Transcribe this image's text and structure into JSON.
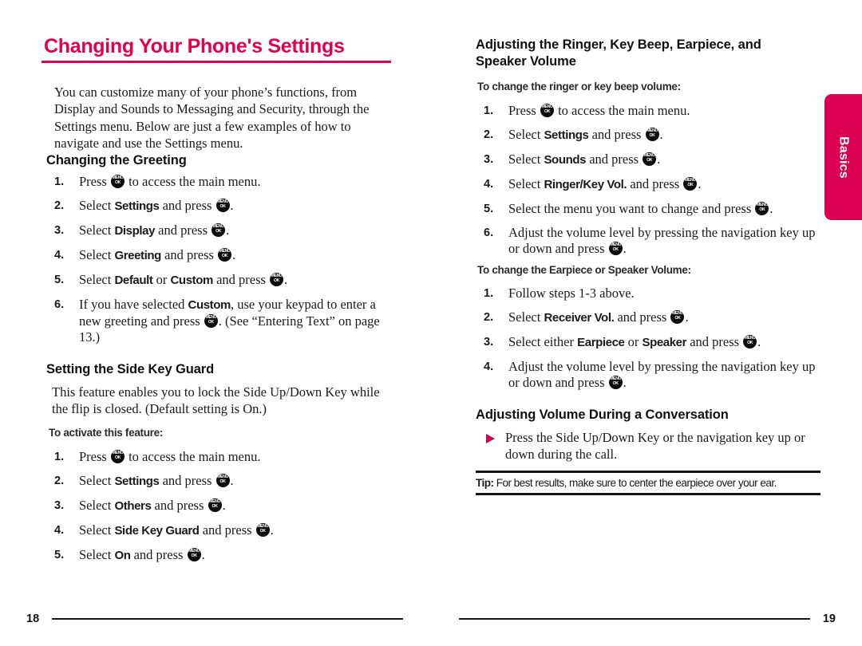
{
  "document": {
    "title": "Changing Your Phone's Settings",
    "accent_color": "#E3004F",
    "menu_key_icon": {
      "line1": "MENU",
      "line2": "OK"
    }
  },
  "side_tab": {
    "label": "Basics"
  },
  "left_page": {
    "folio": "18",
    "intro": "You can customize many of your phone’s functions, from Display and Sounds to Messaging and Security, through the Settings menu. Below are just a few examples of how to navigate and use the Settings menu.",
    "sections": [
      {
        "heading": "Changing the Greeting",
        "steps": [
          {
            "num": "1.",
            "html": "Press <span class=\"menukey\" data-name=\"menu-ok-key-icon\" data-interactable=\"false\"><i class=\"k1\">MENU</i><i class=\"k2\">OK</i></span> to access the main menu."
          },
          {
            "num": "2.",
            "html": "Select <b>Settings</b> and press <span class=\"menukey\" data-name=\"menu-ok-key-icon\" data-interactable=\"false\"><i class=\"k1\">MENU</i><i class=\"k2\">OK</i></span>."
          },
          {
            "num": "3.",
            "html": "Select <b>Display</b> and press <span class=\"menukey\" data-name=\"menu-ok-key-icon\" data-interactable=\"false\"><i class=\"k1\">MENU</i><i class=\"k2\">OK</i></span>."
          },
          {
            "num": "4.",
            "html": "Select <b>Greeting</b> and press <span class=\"menukey\" data-name=\"menu-ok-key-icon\" data-interactable=\"false\"><i class=\"k1\">MENU</i><i class=\"k2\">OK</i></span>."
          },
          {
            "num": "5.",
            "html": "Select <b>Default</b> or <b>Custom</b> and press <span class=\"menukey\" data-name=\"menu-ok-key-icon\" data-interactable=\"false\"><i class=\"k1\">MENU</i><i class=\"k2\">OK</i></span>."
          },
          {
            "num": "6.",
            "html": "If you have selected <b>Custom</b>, use your keypad to enter a new greeting and press <span class=\"menukey\" data-name=\"menu-ok-key-icon\" data-interactable=\"false\"><i class=\"k1\">MENU</i><i class=\"k2\">OK</i></span>. (See “Entering Text” on page 13.)"
          }
        ]
      },
      {
        "heading": "Setting the Side Key Guard",
        "body": "This feature enables you to lock the Side Up/Down Key while the flip is closed. (Default setting is On.)",
        "subhead": "To activate this feature:",
        "steps": [
          {
            "num": "1.",
            "html": "Press <span class=\"menukey\" data-name=\"menu-ok-key-icon\" data-interactable=\"false\"><i class=\"k1\">MENU</i><i class=\"k2\">OK</i></span> to access the main menu."
          },
          {
            "num": "2.",
            "html": "Select <b>Settings</b> and press <span class=\"menukey\" data-name=\"menu-ok-key-icon\" data-interactable=\"false\"><i class=\"k1\">MENU</i><i class=\"k2\">OK</i></span>."
          },
          {
            "num": "3.",
            "html": "Select <b>Others</b> and press <span class=\"menukey\" data-name=\"menu-ok-key-icon\" data-interactable=\"false\"><i class=\"k1\">MENU</i><i class=\"k2\">OK</i></span>."
          },
          {
            "num": "4.",
            "html": "Select <b>Side Key Guard</b> and press <span class=\"menukey\" data-name=\"menu-ok-key-icon\" data-interactable=\"false\"><i class=\"k1\">MENU</i><i class=\"k2\">OK</i></span>."
          },
          {
            "num": "5.",
            "html": "Select <b>On</b> and press <span class=\"menukey\" data-name=\"menu-ok-key-icon\" data-interactable=\"false\"><i class=\"k1\">MENU</i><i class=\"k2\">OK</i></span>."
          }
        ]
      }
    ]
  },
  "right_page": {
    "folio": "19",
    "heading_1": "Adjusting the Ringer, Key Beep, Earpiece, and Speaker Volume",
    "subhead_1": "To change the ringer or key beep volume:",
    "steps_1": [
      {
        "num": "1.",
        "html": "Press <span class=\"menukey\" data-name=\"menu-ok-key-icon\" data-interactable=\"false\"><i class=\"k1\">MENU</i><i class=\"k2\">OK</i></span> to access the main menu."
      },
      {
        "num": "2.",
        "html": "Select <b>Settings</b> and press <span class=\"menukey\" data-name=\"menu-ok-key-icon\" data-interactable=\"false\"><i class=\"k1\">MENU</i><i class=\"k2\">OK</i></span>."
      },
      {
        "num": "3.",
        "html": "Select <b>Sounds</b> and press <span class=\"menukey\" data-name=\"menu-ok-key-icon\" data-interactable=\"false\"><i class=\"k1\">MENU</i><i class=\"k2\">OK</i></span>."
      },
      {
        "num": "4.",
        "html": "Select <b>Ringer/Key Vol.</b> and press <span class=\"menukey\" data-name=\"menu-ok-key-icon\" data-interactable=\"false\"><i class=\"k1\">MENU</i><i class=\"k2\">OK</i></span>."
      },
      {
        "num": "5.",
        "html": "Select the menu you want to change and press <span class=\"menukey\" data-name=\"menu-ok-key-icon\" data-interactable=\"false\"><i class=\"k1\">MENU</i><i class=\"k2\">OK</i></span>."
      },
      {
        "num": "6.",
        "html": "Adjust the volume level by pressing the navigation key up or down and press <span class=\"menukey\" data-name=\"menu-ok-key-icon\" data-interactable=\"false\"><i class=\"k1\">MENU</i><i class=\"k2\">OK</i></span>."
      }
    ],
    "subhead_2": "To change the Earpiece or Speaker Volume:",
    "steps_2": [
      {
        "num": "1.",
        "html": "Follow steps 1-3 above."
      },
      {
        "num": "2.",
        "html": "Select <b>Receiver Vol.</b> and press <span class=\"menukey\" data-name=\"menu-ok-key-icon\" data-interactable=\"false\"><i class=\"k1\">MENU</i><i class=\"k2\">OK</i></span>."
      },
      {
        "num": "3.",
        "html": "Select either <b>Earpiece</b> or <b>Speaker</b> and press <span class=\"menukey\" data-name=\"menu-ok-key-icon\" data-interactable=\"false\"><i class=\"k1\">MENU</i><i class=\"k2\">OK</i></span>."
      },
      {
        "num": "4.",
        "html": "Adjust the volume level by pressing the navigation key up or down and press <span class=\"menukey\" data-name=\"menu-ok-key-icon\" data-interactable=\"false\"><i class=\"k1\">MENU</i><i class=\"k2\">OK</i></span>."
      }
    ],
    "heading_2": "Adjusting Volume During a Conversation",
    "bullets": [
      {
        "html": "Press the Side Up/Down Key or the navigation key up or down during the call."
      }
    ],
    "tip": {
      "label": "Tip:",
      "text": " For best results, make sure to center the earpiece over your ear."
    }
  }
}
